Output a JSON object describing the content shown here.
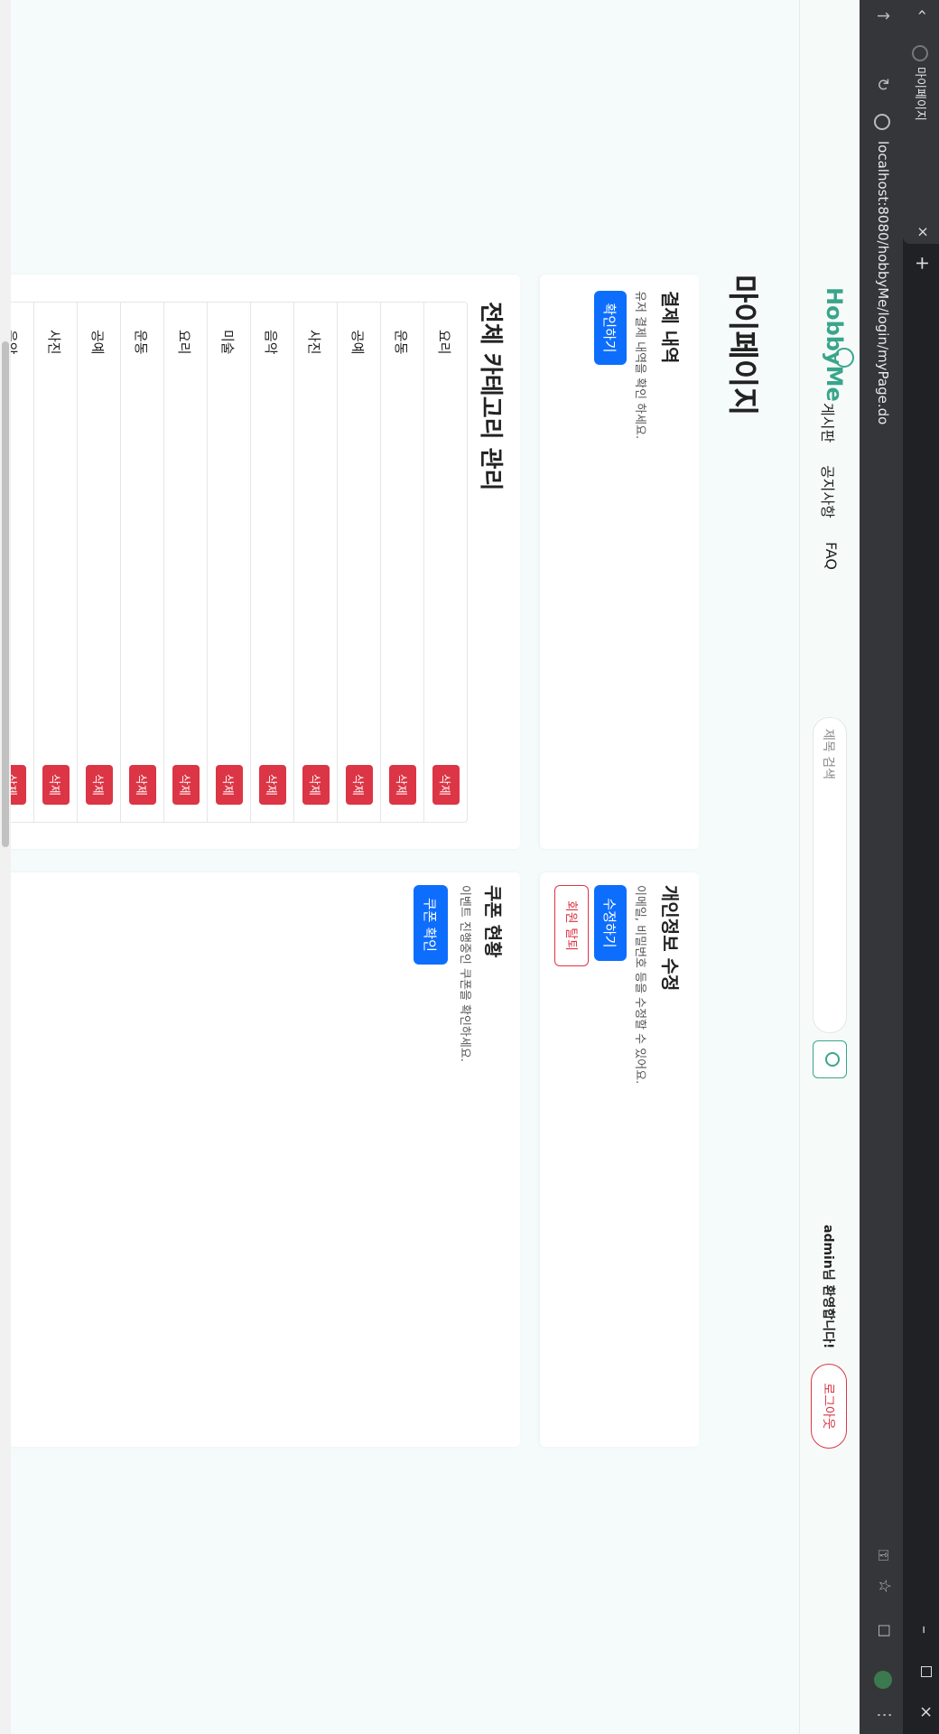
{
  "browser": {
    "tab_title": "마이페이지",
    "url": "localhost:8080/hobbyMe/login/myPage.do"
  },
  "header": {
    "logo_text": "HobbyMe",
    "nav": [
      "게시판",
      "공지사항",
      "FAQ"
    ],
    "search_placeholder": "제목 검색",
    "welcome": "admin님 환영합니다!",
    "logout_label": "로그아웃"
  },
  "page_title": "마이페이지",
  "payment": {
    "title": "결제 내역",
    "desc": "유저 결제 내역을 확인 하세요.",
    "button": "확인하기"
  },
  "profile": {
    "title": "개인정보 수정",
    "desc": "이메일, 비밀번호 등을 수정할 수 있어요.",
    "edit_button": "수정하기",
    "withdraw_button": "회원 탈퇴"
  },
  "categories": {
    "title": "전체 카테고리 관리",
    "items": [
      {
        "name": "요리",
        "action": "삭제"
      },
      {
        "name": "운동",
        "action": "삭제"
      },
      {
        "name": "공예",
        "action": "삭제"
      },
      {
        "name": "사진",
        "action": "삭제"
      },
      {
        "name": "음악",
        "action": "삭제"
      },
      {
        "name": "미술",
        "action": "삭제"
      },
      {
        "name": "요리",
        "action": "삭제"
      },
      {
        "name": "운동",
        "action": "삭제"
      },
      {
        "name": "공예",
        "action": "삭제"
      },
      {
        "name": "사진",
        "action": "삭제"
      },
      {
        "name": "음악",
        "action": "삭제"
      }
    ]
  },
  "coupon": {
    "title": "쿠폰 현황",
    "desc": "이벤트 진행중인 쿠폰을 확인하세요.",
    "button": "쿠폰 확인"
  },
  "colors": {
    "brand": "#3aa58b",
    "primary": "#0d6efd",
    "danger": "#dc3545"
  }
}
